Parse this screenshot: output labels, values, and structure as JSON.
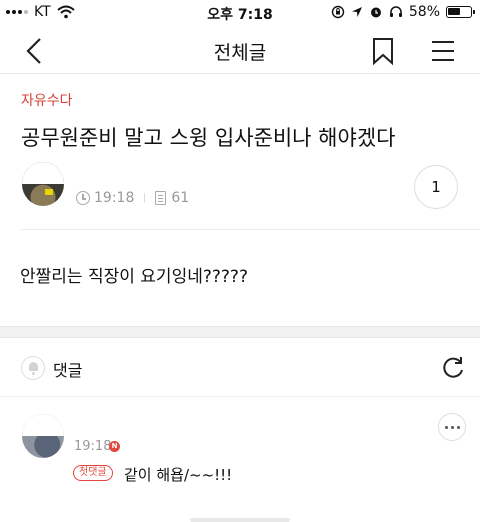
{
  "status_bar": {
    "carrier": "KT",
    "time": "오후 7:18",
    "battery": "58%",
    "battery_level": 0.58
  },
  "nav": {
    "title": "전체글"
  },
  "post": {
    "category": "자유수다",
    "title": "공무원준비 말고 스윙 입사준비나 해야겠다",
    "time": "19:18",
    "views": "61",
    "comment_count": "1",
    "body": "안짤리는 직장이 요기잉네?????"
  },
  "comments": {
    "header_label": "댓글",
    "items": [
      {
        "time": "19:18",
        "new_badge": "N",
        "first_badge": "첫댓글",
        "text": "같이 해욥/~~!!!"
      }
    ]
  },
  "colors": {
    "accent": "#d9433a",
    "muted": "#999999"
  }
}
